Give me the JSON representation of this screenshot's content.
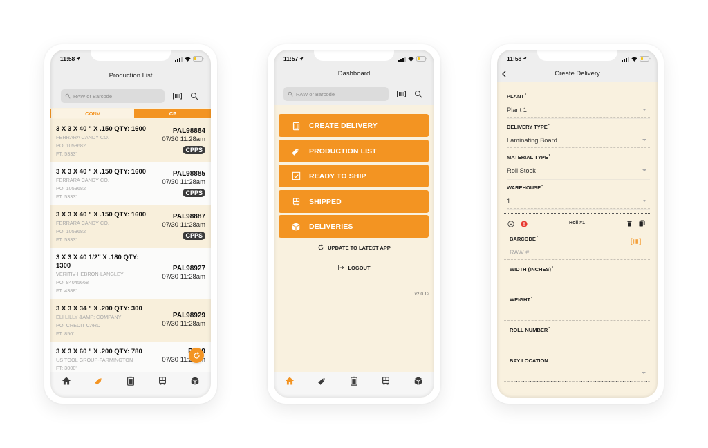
{
  "colors": {
    "accent": "#f39422",
    "cream": "#f8efdb",
    "header_gray": "#eeeeee",
    "badge_dark": "#3a3a3a",
    "alert_red": "#e8392f"
  },
  "production_list": {
    "status_time": "11:58",
    "title": "Production List",
    "search_placeholder": "RAW or Barcode",
    "tabs": [
      {
        "label": "CONV",
        "active": false
      },
      {
        "label": "CP",
        "active": true
      }
    ],
    "items": [
      {
        "title": "3 X 3 X 40 \" X .150 QTY: 1600",
        "customer": "FERRARA CANDY CO.",
        "po": "PO: 1053682",
        "ft": "FT: 5333'",
        "pallet": "PAL98884",
        "date": "07/30 11:28am",
        "badge": "CPPS"
      },
      {
        "title": "3 X 3 X 40 \" X .150 QTY: 1600",
        "customer": "FERRARA CANDY CO.",
        "po": "PO: 1053682",
        "ft": "FT: 5333'",
        "pallet": "PAL98885",
        "date": "07/30 11:28am",
        "badge": "CPPS"
      },
      {
        "title": "3 X 3 X 40 \" X .150 QTY: 1600",
        "customer": "FERRARA CANDY CO.",
        "po": "PO: 1053682",
        "ft": "FT: 5333'",
        "pallet": "PAL98887",
        "date": "07/30 11:28am",
        "badge": "CPPS"
      },
      {
        "title": "3 X 3 X 40 1/2\" X .180 QTY: 1300",
        "customer": "VERITIV-HEBRON-LANGLEY",
        "po": "PO: 84045668",
        "ft": "FT: 4388'",
        "pallet": "PAL98927",
        "date": "07/30 11:28am",
        "badge": null
      },
      {
        "title": "3 X 3 X 34 \" X .200 QTY: 300",
        "customer": "ELI LILLY &AMP; COMPANY",
        "po": "PO: CREDIT CARD",
        "ft": "FT: 850'",
        "pallet": "PAL98929",
        "date": "07/30 11:28am",
        "badge": null
      },
      {
        "title": "3 X 3 X 60 \" X .200 QTY: 780",
        "customer": "US TOOL GROUP-FARMINGTON",
        "po": "FT: 3000'",
        "ft": "",
        "pallet": "PAL9",
        "date": "07/30 11:28am",
        "badge": null
      }
    ],
    "refresh_icon": "refresh-icon",
    "tabbar": {
      "icons": [
        "home",
        "tag",
        "clipboard",
        "bus",
        "cube"
      ],
      "active": "tag"
    }
  },
  "dashboard": {
    "status_time": "11:57",
    "title": "Dashboard",
    "search_placeholder": "RAW or Barcode",
    "menu": [
      {
        "label": "CREATE DELIVERY",
        "icon": "clipboard"
      },
      {
        "label": "PRODUCTION LIST",
        "icon": "tag"
      },
      {
        "label": "READY TO SHIP",
        "icon": "checkbox"
      },
      {
        "label": "SHIPPED",
        "icon": "bus"
      },
      {
        "label": "DELIVERIES",
        "icon": "cube"
      }
    ],
    "update_link": "UPDATE TO LATEST APP",
    "logout_link": "LOGOUT",
    "version": "v2.0.12",
    "tabbar": {
      "icons": [
        "home",
        "tag",
        "clipboard",
        "bus",
        "cube"
      ],
      "active": "home"
    }
  },
  "create_delivery": {
    "status_time": "11:58",
    "title": "Create Delivery",
    "required_mark": "*",
    "fields": [
      {
        "label": "PLANT",
        "required": true,
        "value": "Plant 1"
      },
      {
        "label": "DELIVERY TYPE",
        "required": true,
        "value": "Laminating Board"
      },
      {
        "label": "MATERIAL TYPE",
        "required": true,
        "value": "Roll Stock"
      },
      {
        "label": "WAREHOUSE",
        "required": true,
        "value": "1"
      }
    ],
    "roll": {
      "title": "Roll #1",
      "fields": [
        {
          "label": "BARCODE",
          "required": true,
          "placeholder": "RAW #",
          "value": ""
        },
        {
          "label": "WIDTH (INCHES)",
          "required": true,
          "value": ""
        },
        {
          "label": "WEIGHT",
          "required": true,
          "value": ""
        },
        {
          "label": "ROLL NUMBER",
          "required": true,
          "value": ""
        },
        {
          "label": "BAY LOCATION",
          "required": false,
          "value": ""
        }
      ]
    }
  }
}
